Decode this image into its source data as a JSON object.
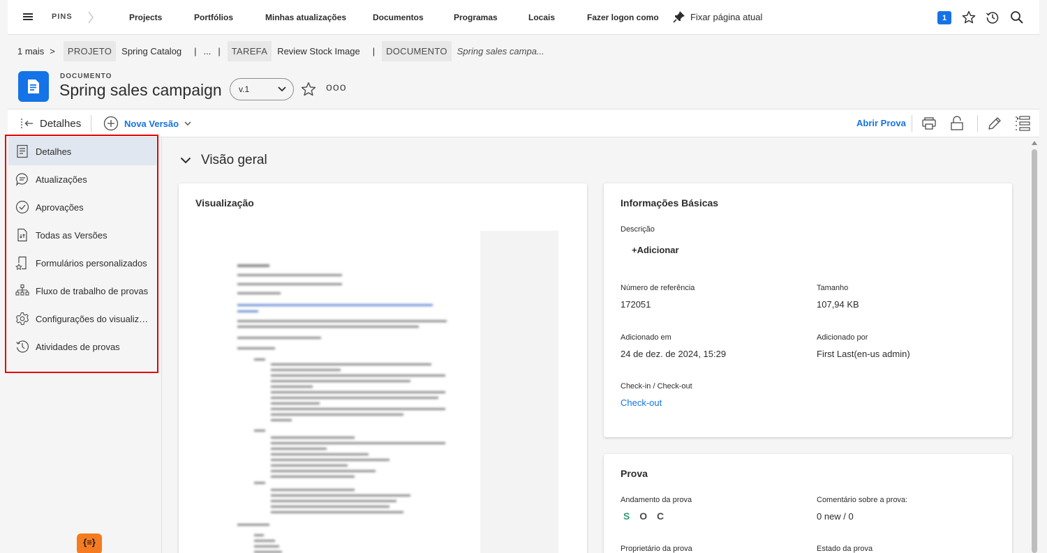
{
  "topnav": {
    "pins_label": "PINS",
    "links": [
      "Projects",
      "Portfólios",
      "Minhas atualizações",
      "Documentos",
      "Programas",
      "Locais",
      "Fazer logon como"
    ],
    "pin_page_label": "Fixar página atual",
    "notification_count": "1"
  },
  "breadcrumb": {
    "more": "1 mais",
    "more_sep": ">",
    "project_tag": "PROJETO",
    "project_name": "Spring Catalog",
    "ellipsis": "...",
    "task_tag": "TAREFA",
    "task_name": "Review Stock Image",
    "doc_tag": "DOCUMENTO",
    "doc_name": "Spring sales campa...",
    "sep": "|"
  },
  "header": {
    "object_type": "DOCUMENTO",
    "title": "Spring sales campaign",
    "version": "v.1",
    "more": "ooo"
  },
  "toolbar": {
    "details_label": "Detalhes",
    "new_version_label": "Nova Versão",
    "open_proof_label": "Abrir Prova"
  },
  "sidebar": {
    "items": [
      {
        "label": "Detalhes",
        "icon": "document-details-icon"
      },
      {
        "label": "Atualizações",
        "icon": "comment-bubble-icon"
      },
      {
        "label": "Aprovações",
        "icon": "check-circle-icon"
      },
      {
        "label": "Todas as Versões",
        "icon": "file-versions-icon"
      },
      {
        "label": "Formulários personalizados",
        "icon": "custom-form-icon"
      },
      {
        "label": "Fluxo de trabalho de provas",
        "icon": "workflow-tree-icon"
      },
      {
        "label": "Configurações do visualizad...",
        "icon": "gear-icon"
      },
      {
        "label": "Atividades de provas",
        "icon": "history-clock-icon"
      }
    ],
    "app_logo_text": "{≡}"
  },
  "main": {
    "overview_title": "Visão geral",
    "preview_card": {
      "title": "Visualização"
    },
    "basic_info": {
      "title": "Informações Básicas",
      "description_label": "Descrição",
      "add_label": "+Adicionar",
      "ref_label": "Número de referência",
      "ref_value": "172051",
      "size_label": "Tamanho",
      "size_value": "107,94 KB",
      "added_on_label": "Adicionado em",
      "added_on_value": "24 de dez. de 2024, 15:29",
      "added_by_label": "Adicionado por",
      "added_by_value": "First Last(en-us admin)",
      "checkin_label": "Check-in / Check-out",
      "checkin_value": "Check-out"
    },
    "proof_card": {
      "title": "Prova",
      "progress_label": "Andamento da prova",
      "progress_letters": [
        "S",
        "O",
        "C"
      ],
      "progress_colors": [
        "#2d9d78",
        "#4b4b4b",
        "#4b4b4b"
      ],
      "comment_label": "Comentário sobre a prova:",
      "comment_value": "0 new / 0",
      "owner_label": "Proprietário da prova",
      "state_label": "Estado da prova"
    }
  },
  "colors": {
    "accent": "#1473e6",
    "highlight": "#e60000",
    "active_item": "#e1e7f0",
    "logo": "#f47b20"
  }
}
